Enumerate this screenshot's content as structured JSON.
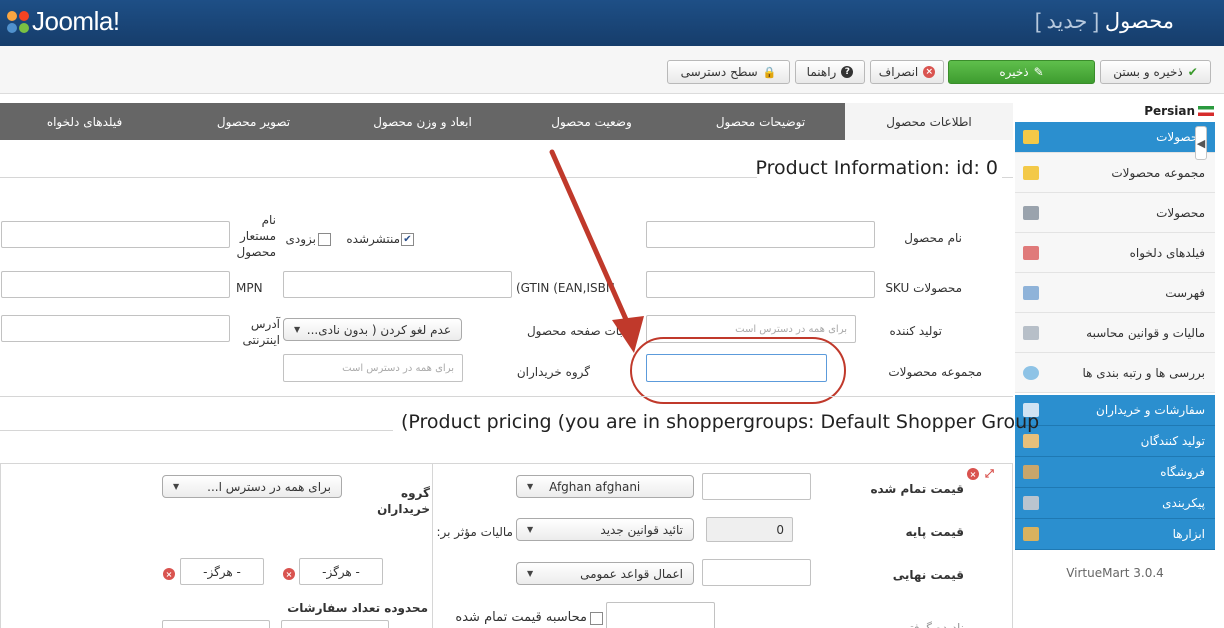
{
  "header": {
    "logo": "Joomla!",
    "title_main": "محصول",
    "title_sub": "[ جدید ]"
  },
  "toolbar": {
    "save_close": "ذخیره و بستن",
    "save": "ذخیره",
    "cancel": "انصراف",
    "help": "راهنما",
    "access": "سطح دسترسی"
  },
  "sidebar": {
    "language": "Persian",
    "items": [
      {
        "label": "محصولات"
      },
      {
        "label": "مجموعه محصولات"
      },
      {
        "label": "محصولات"
      },
      {
        "label": "فیلدهای دلخواه"
      },
      {
        "label": "فهرست"
      },
      {
        "label": "مالیات و قوانین محاسبه"
      },
      {
        "label": "بررسی ها و رتبه بندی ها"
      }
    ],
    "sections": [
      {
        "label": "سفارشات و خریداران"
      },
      {
        "label": "تولید کنندگان"
      },
      {
        "label": "فروشگاه"
      },
      {
        "label": "پیکربندی"
      },
      {
        "label": "ابزارها"
      }
    ],
    "version": "VirtueMart 3.0.4"
  },
  "tabs": [
    {
      "label": "اطلاعات محصول"
    },
    {
      "label": "توضیحات محصول"
    },
    {
      "label": "وضعیت محصول"
    },
    {
      "label": "ابعاد و وزن محصول"
    },
    {
      "label": "تصویر محصول"
    },
    {
      "label": "فیلدهای دلخواه"
    }
  ],
  "info": {
    "title": "Product Information: id: 0",
    "product_name": "نام محصول",
    "published": "منتشرشده",
    "coming_soon": "بزودی",
    "alias_l1": "نام",
    "alias_l2": "مستعار",
    "alias_l3": "محصول",
    "sku": "محصولات SKU",
    "gtin": "(GTIN (EAN,ISBN",
    "mpn": "MPN",
    "manufacturer": "تولید کننده",
    "manufacturer_placeholder": "برای همه در دسترس است",
    "page_order": "ترتیبات صفحه محصول",
    "page_order_value": "عدم لغو کردن ( بدون نادی...",
    "url_l1": "آدرس",
    "url_l2": "اینترنتی",
    "categories": "مجموعه محصولات",
    "shopper_groups": "گروه خریداران",
    "shopper_groups_placeholder": "برای همه در دسترس است"
  },
  "pricing": {
    "title": "(Product pricing (you are in shoppergroups: Default Shopper Group",
    "cost_price": "قیمت تمام شده",
    "currency": "Afghan afghani",
    "shopper_group": "گروه خریداران",
    "shopper_group_value": "برای همه در دسترس ا...",
    "base_price": "قیمت پایه",
    "base_price_value": "0",
    "tax_rule": "تائید قوانین جدید",
    "effective_tax": "مالیات مؤثر بر:",
    "final_price": "قیمت نهایی",
    "discount_rule": "اعمال قواعد عمومی",
    "never_1": "- هرگز-",
    "never_2": "- هرگز-",
    "order_limit": "محدوده تعداد سفارشات",
    "calc_cost": "محاسبه قیمت تمام شده",
    "partial_label": "نادیده گرفتن"
  },
  "colors": {
    "header_bg": "#1e4f86",
    "accent_blue": "#2b8fcf",
    "save_green": "#4cae3b",
    "annotation_red": "#c0392b"
  }
}
